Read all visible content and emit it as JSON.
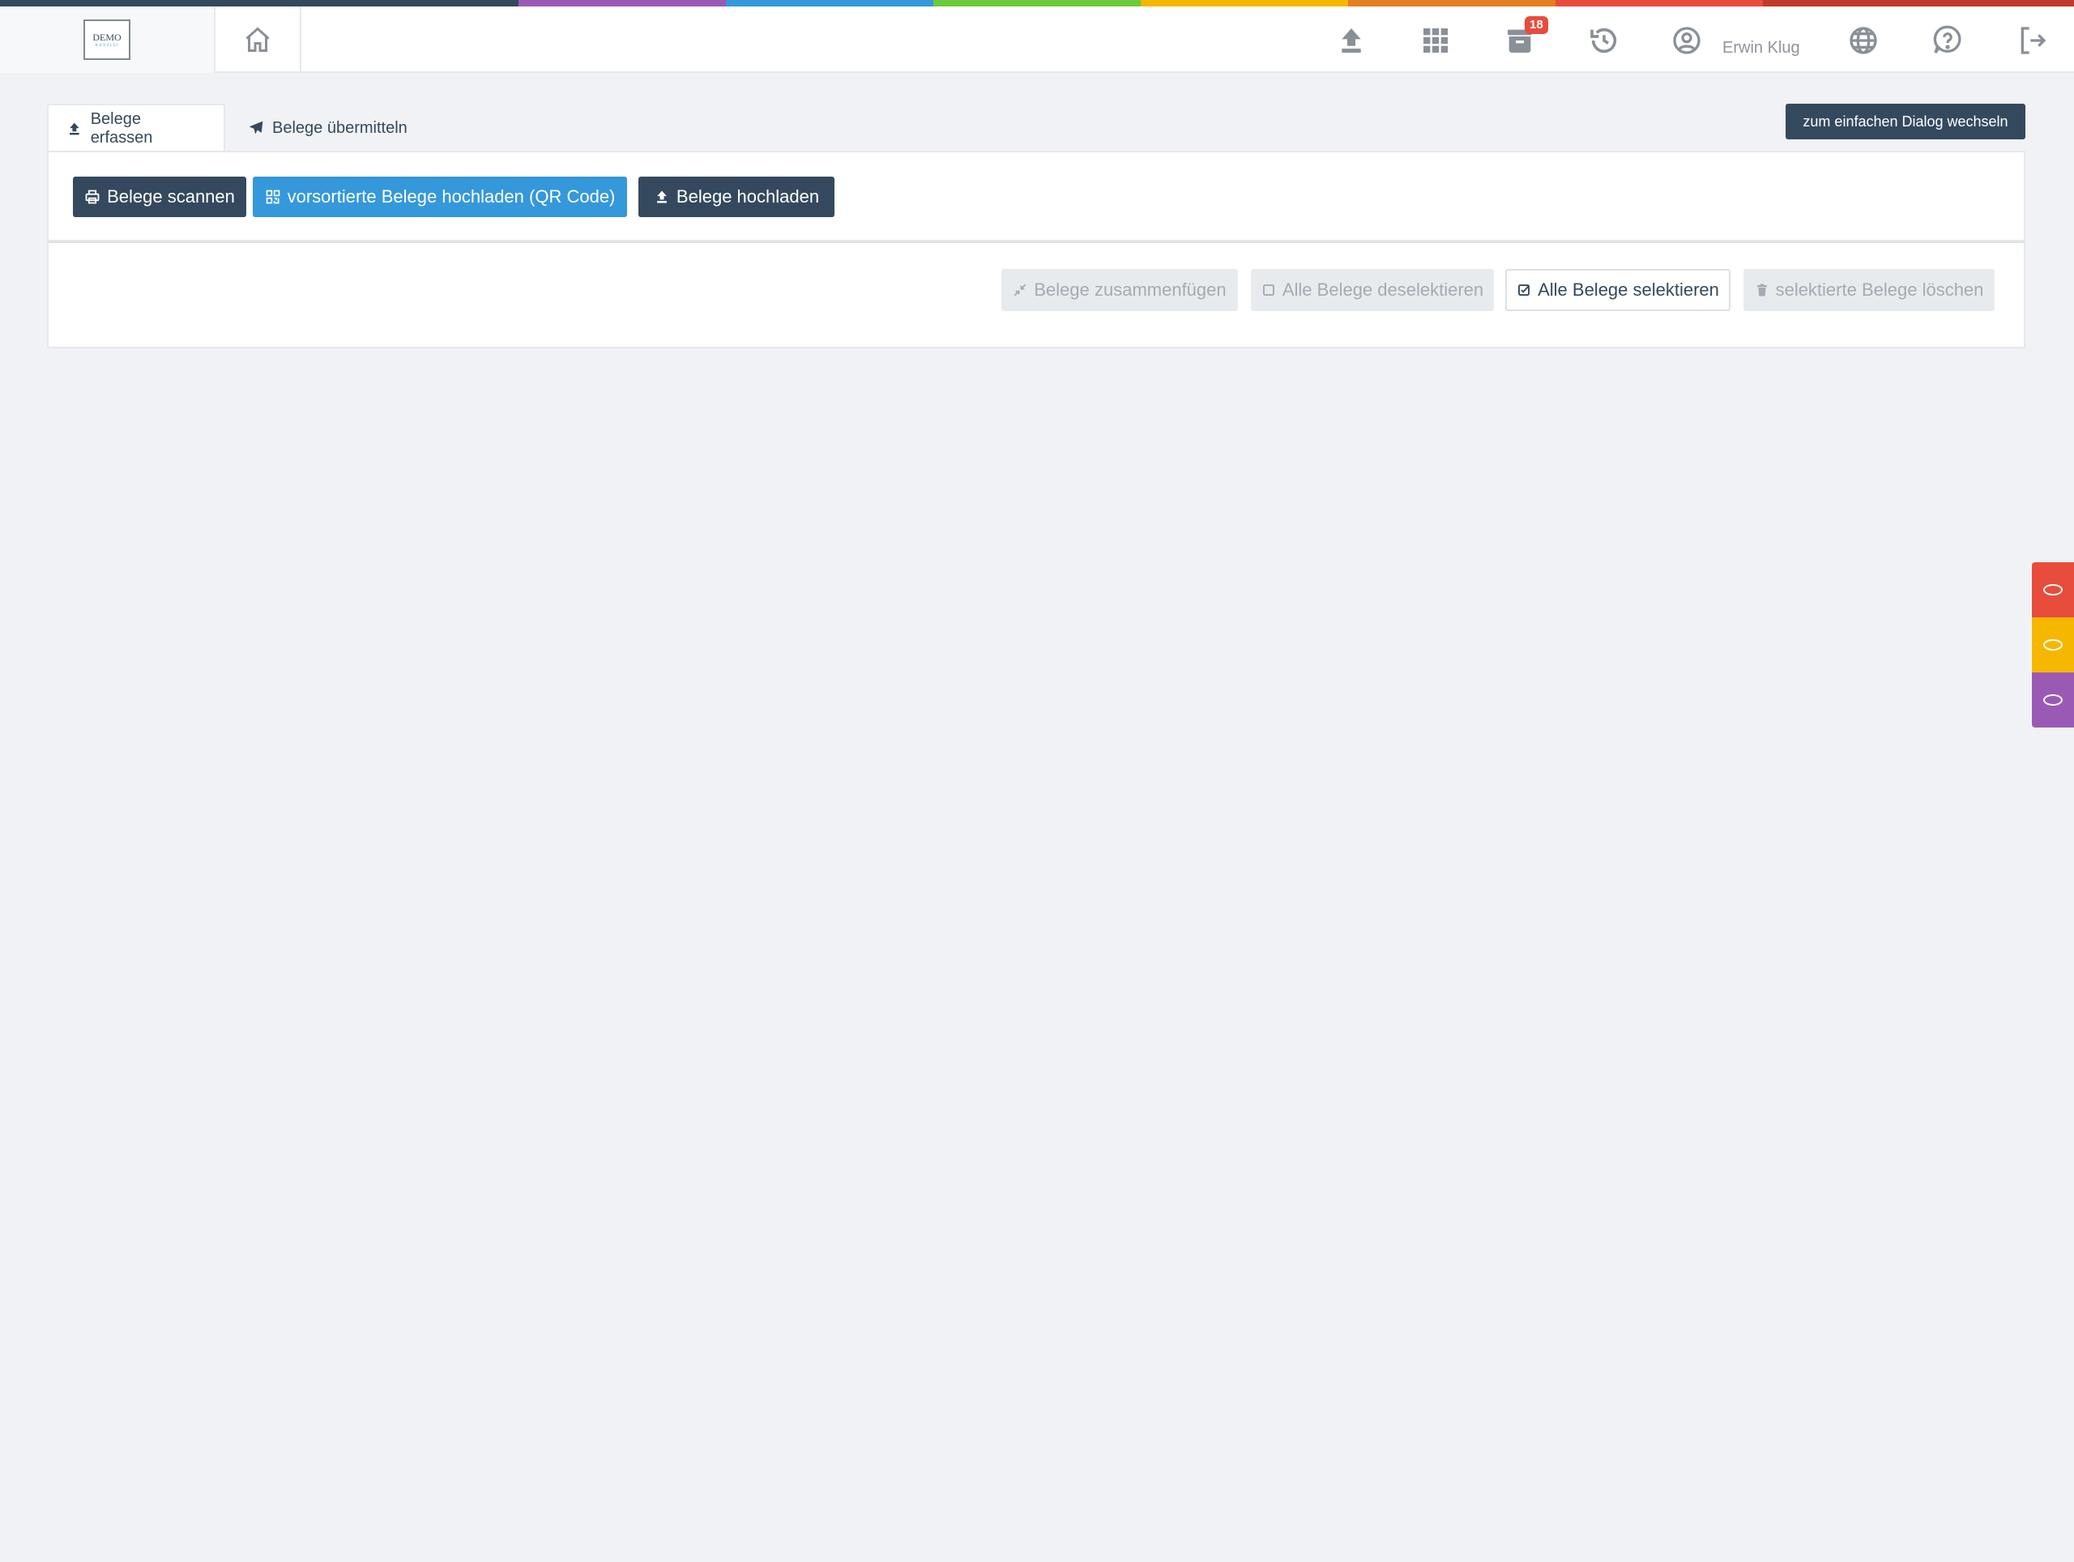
{
  "top_stripe_colors": [
    "#34495e",
    "#9b59b6",
    "#3498db",
    "#6bc93c",
    "#f5b700",
    "#e67e22",
    "#e74c3c",
    "#c0392b"
  ],
  "logo": {
    "text": "DEMO",
    "subtext": "KANZLEI"
  },
  "header": {
    "icons": [
      "home-icon",
      "upload-icon",
      "apps-grid-icon",
      "archive-icon",
      "history-icon",
      "user-icon",
      "globe-icon",
      "help-icon",
      "logout-icon"
    ],
    "archive_badge": "18",
    "user_name": "Erwin Klug"
  },
  "tabs": [
    {
      "label": "Belege erfassen",
      "icon": "upload-icon",
      "active": true
    },
    {
      "label": "Belege übermitteln",
      "icon": "send-icon",
      "active": false
    }
  ],
  "switch_dialog_label": "zum einfachen Dialog wechseln",
  "actions": {
    "scan": "Belege scannen",
    "qr_upload": "vorsortierte Belege hochladen (QR Code)",
    "upload": "Belege hochladen"
  },
  "toolbar": {
    "merge": "Belege zusammenfügen",
    "deselect_all": "Alle Belege deselektieren",
    "select_all": "Alle Belege selektieren",
    "delete_selected": "selektierte Belege löschen"
  },
  "side_tabs": [
    {
      "color": "#e74c3c"
    },
    {
      "color": "#f5b700"
    },
    {
      "color": "#9b59b6"
    }
  ],
  "colors": {
    "primary_dark": "#34495e",
    "primary_blue": "#3498db",
    "badge_red": "#e74c3c"
  }
}
